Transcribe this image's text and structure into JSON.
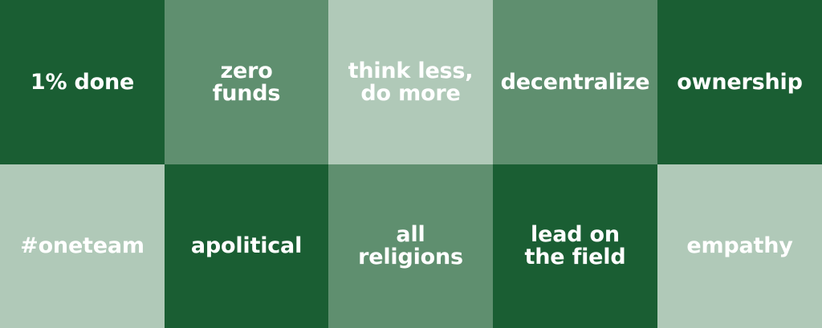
{
  "colors": {
    "dark": "#1a5e33",
    "mid": "#5f8f6f",
    "light": "#b0c9b8",
    "text": "#ffffff"
  },
  "tiles": [
    {
      "label": "1% done",
      "shade": "dark"
    },
    {
      "label": "zero\nfunds",
      "shade": "mid"
    },
    {
      "label": "think less,\ndo more",
      "shade": "light"
    },
    {
      "label": "decentralize",
      "shade": "mid"
    },
    {
      "label": "ownership",
      "shade": "dark"
    },
    {
      "label": "#oneteam",
      "shade": "light"
    },
    {
      "label": "apolitical",
      "shade": "dark"
    },
    {
      "label": "all\nreligions",
      "shade": "mid"
    },
    {
      "label": "lead on\nthe field",
      "shade": "dark"
    },
    {
      "label": "empathy",
      "shade": "light"
    }
  ]
}
